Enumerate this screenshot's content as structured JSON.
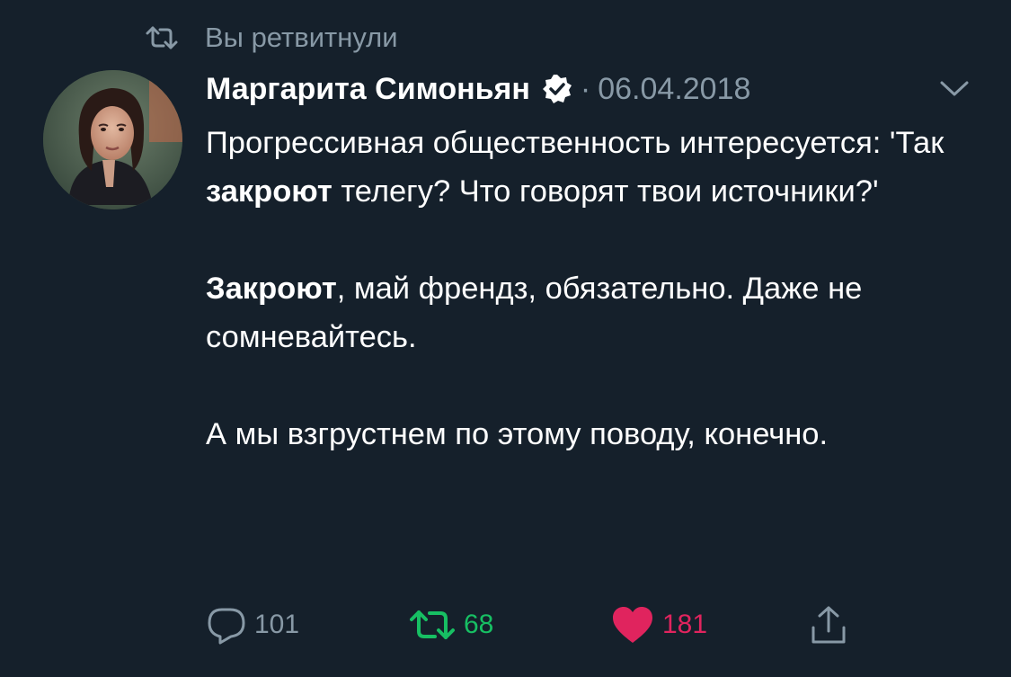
{
  "retweet_context": {
    "icon": "retweet-icon",
    "label": "Вы ретвитнули"
  },
  "author": {
    "name": "Маргарита Симоньян",
    "verified": true,
    "verified_icon": "verified-badge-icon"
  },
  "date_separator": "·",
  "date": "06.04.2018",
  "menu_icon": "chevron-down-icon",
  "tweet_text": {
    "p1_part1": "Прогрессивная общественность интересуется: 'Так ",
    "p1_bold": "закроют",
    "p1_part2": " телегу? Что говорят твои источники?'",
    "p2_bold": "Закроют",
    "p2_part1": ", май френдз, обязательно. Даже не сомневайтесь.",
    "p3": "А мы взгрустнем по этому поводу, конечно."
  },
  "actions": {
    "reply": {
      "icon": "reply-icon",
      "count": "101"
    },
    "retweet": {
      "icon": "retweet-icon",
      "count": "68",
      "active": true
    },
    "like": {
      "icon": "heart-icon",
      "count": "181",
      "active": true
    },
    "share": {
      "icon": "share-icon"
    }
  },
  "colors": {
    "background": "#15202b",
    "text": "#ffffff",
    "muted": "#8899a6",
    "retweet_active": "#17bf63",
    "like_active": "#e0245e"
  }
}
